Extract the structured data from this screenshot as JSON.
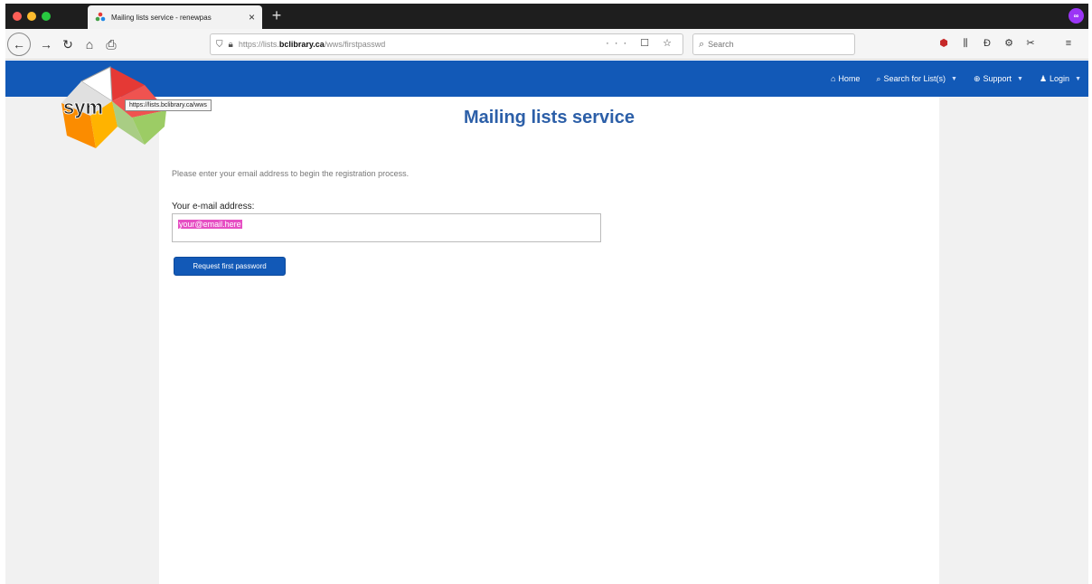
{
  "browser": {
    "tab_title": "Mailing lists service - renewpas",
    "url_protocol": "https://lists.",
    "url_domain": "bclibrary.ca",
    "url_path": "/wws/firstpasswd",
    "url_actions": "··· ☐ ☆",
    "search_placeholder": "Search",
    "profile_badge": "∞"
  },
  "nav": {
    "items": [
      {
        "icon": "home-icon",
        "label": "Home"
      },
      {
        "icon": "search-icon",
        "label": "Search for List(s)"
      },
      {
        "icon": "support-icon",
        "label": "Support"
      },
      {
        "icon": "user-icon",
        "label": "Login"
      }
    ]
  },
  "logo": {
    "text": "sym",
    "tooltip": "https://lists.bclibrary.ca/wws"
  },
  "page": {
    "title": "Mailing lists service",
    "intro": "Please enter your email address to begin the registration process.",
    "email_label": "Your e-mail address:",
    "email_value": "your@email.here",
    "submit_label": "Request first password"
  },
  "colors": {
    "brand": "#1259b7",
    "title": "#2c5fa8",
    "selection": "#e64fc3"
  }
}
